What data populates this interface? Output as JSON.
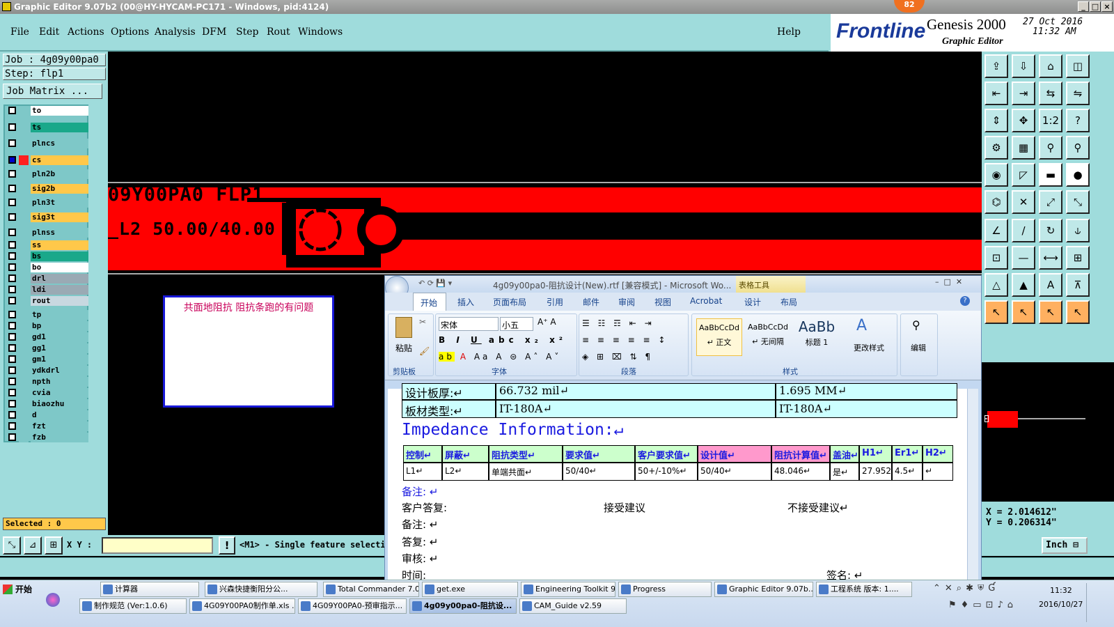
{
  "titlebar": {
    "title": "Graphic Editor 9.07b2 (00@HY-HYCAM-PC171 - Windows, pid:4124)"
  },
  "menu": [
    "File",
    "Edit",
    "Actions",
    "Options",
    "Analysis",
    "DFM",
    "Step",
    "Rout",
    "Windows"
  ],
  "help": "Help",
  "brand": {
    "logo": "Frontline",
    "product": "Genesis 2000",
    "subtitle": "Graphic Editor",
    "date": "27 Oct 2016",
    "time": "11:32 AM",
    "badge": "82"
  },
  "job": {
    "job_line": "Job : 4g09y00pa0",
    "step_line": "Step: flp1",
    "matrix_button": "Job Matrix ..."
  },
  "layers": [
    {
      "name": "to",
      "color": "#ffffff",
      "checked": false
    },
    {
      "name": "ts",
      "color": "#1aa88a",
      "checked": false
    },
    {
      "name": "plncs",
      "color": "#7ec8c8",
      "checked": false
    },
    {
      "name": "cs",
      "color": "#ffc84a",
      "checked": true
    },
    {
      "name": "pln2b",
      "color": "#7ec8c8",
      "checked": false
    },
    {
      "name": "sig2b",
      "color": "#ffc84a",
      "checked": false
    },
    {
      "name": "pln3t",
      "color": "#7ec8c8",
      "checked": false
    },
    {
      "name": "sig3t",
      "color": "#ffc84a",
      "checked": false
    },
    {
      "name": "plnss",
      "color": "#7ec8c8",
      "checked": false
    },
    {
      "name": "ss",
      "color": "#ffc84a",
      "checked": false
    },
    {
      "name": "bs",
      "color": "#1aa88a",
      "checked": false
    },
    {
      "name": "bo",
      "color": "#ffffff",
      "checked": false
    },
    {
      "name": "drl",
      "color": "#9aaab4",
      "checked": false
    },
    {
      "name": "ldi",
      "color": "#9aaab4",
      "checked": false
    },
    {
      "name": "rout",
      "color": "#c8d8e0",
      "checked": false
    },
    {
      "name": "tp",
      "color": "#7ec8c8",
      "checked": false
    },
    {
      "name": "bp",
      "color": "#7ec8c8",
      "checked": false
    },
    {
      "name": "gd1",
      "color": "#7ec8c8",
      "checked": false
    },
    {
      "name": "gg1",
      "color": "#7ec8c8",
      "checked": false
    },
    {
      "name": "gm1",
      "color": "#7ec8c8",
      "checked": false
    },
    {
      "name": "ydkdrl",
      "color": "#7ec8c8",
      "checked": false
    },
    {
      "name": "npth",
      "color": "#7ec8c8",
      "checked": false
    },
    {
      "name": "cvia",
      "color": "#7ec8c8",
      "checked": false
    },
    {
      "name": "biaozhu",
      "color": "#7ec8c8",
      "checked": false
    },
    {
      "name": "d",
      "color": "#7ec8c8",
      "checked": false
    },
    {
      "name": "fzt",
      "color": "#7ec8c8",
      "checked": false
    },
    {
      "name": "fzb",
      "color": "#7ec8c8",
      "checked": false
    }
  ],
  "selected": "Selected : 0",
  "canvas": {
    "text1": "09Y00PA0 FLP1",
    "text2": "_L2 50.00/40.00 $",
    "note": "共面地阻抗 阻抗条跑的有问题"
  },
  "coords": {
    "x": "X = 2.014612\"",
    "y": "Y = 0.206314\""
  },
  "bottombar": {
    "xy_label": "X Y :",
    "xy_value": "",
    "mode_text": "<M1> - Single feature selecti",
    "units": "Inch"
  },
  "word": {
    "title": "4g09y00pa0-阻抗设计(New).rtf [兼容模式] - Microsoft Wo...",
    "context_tab": "表格工具",
    "tabs": [
      "开始",
      "插入",
      "页面布局",
      "引用",
      "邮件",
      "审阅",
      "视图",
      "Acrobat",
      "设计",
      "布局"
    ],
    "ribbon": {
      "paste": "粘贴",
      "clipboard": "剪贴板",
      "font_name": "宋体",
      "font_size": "小五",
      "font_group": "字体",
      "para_group": "段落",
      "style_group": "样式",
      "styles": [
        {
          "sample": "AaBbCcDd",
          "name": "↵ 正文"
        },
        {
          "sample": "AaBbCcDd",
          "name": "↵ 无间隔"
        },
        {
          "sample": "AaBb",
          "name": "标题 1"
        }
      ],
      "change_style": "更改样式",
      "edit": "编辑"
    },
    "doc": {
      "row1": [
        "设计板厚:↵",
        "66.732 mil↵",
        "1.695 MM↵"
      ],
      "row2": [
        "板材类型:↵",
        "IT-180A↵",
        "IT-180A↵"
      ],
      "heading": "Impedance Information:↵",
      "headers": [
        "控制↵",
        "屏蔽↵",
        "阻抗类型↵",
        "要求值↵",
        "客户要求值↵",
        "设计值↵",
        "阻抗计算值↵",
        "盖油↵",
        "H1↵",
        "Er1↵",
        "H2↵"
      ],
      "values": [
        "L1↵",
        "L2↵",
        "单端共面↵",
        "50/40↵",
        "50+/-10%↵",
        "50/40↵",
        "48.046↵",
        "是↵",
        "27.952↵",
        "4.5↵",
        "↵"
      ],
      "remark1": "备注: ↵",
      "reply_label": "客户答复:",
      "accept": "接受建议",
      "reject": "不接受建议↵",
      "remark2": "备注: ↵",
      "answer": "答复: ↵",
      "review": "审核: ↵",
      "time": "时间:",
      "sign": "签名: ↵"
    }
  },
  "taskbar": {
    "start": "开始",
    "row1": [
      "计算器",
      "兴森快捷衡阳分公...",
      "Total Commander 7.0...",
      "get.exe",
      "Engineering Toolkit 9....",
      "Progress",
      "Graphic Editor 9.07b...",
      "工程系统  版本: 1...."
    ],
    "row2": [
      "制作规范 (Ver:1.0.6)",
      "4G09Y00PA0制作单.xls ...",
      "4G09Y00PA0-预审指示...",
      "4g09y00pa0-阻抗设...",
      "CAM_Guide v2.59"
    ],
    "clock_time": "11:32",
    "clock_date": "2016/10/27"
  }
}
